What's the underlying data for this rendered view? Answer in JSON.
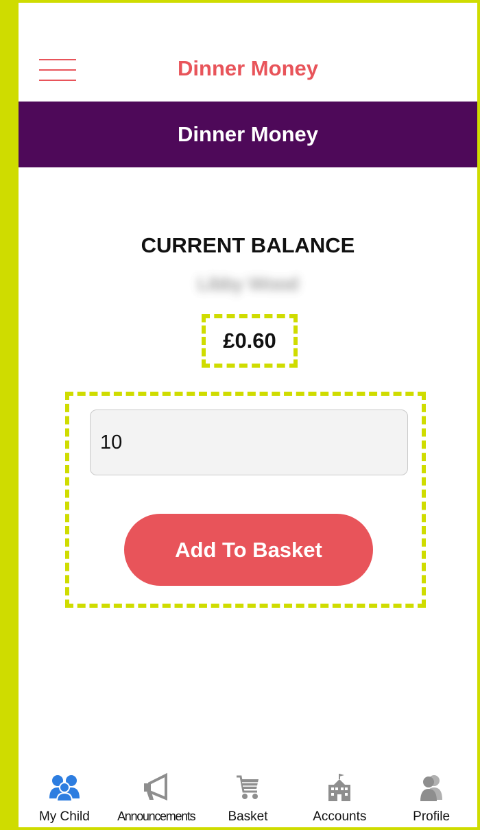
{
  "header": {
    "title": "Dinner Money",
    "menu_icon": "hamburger-menu-icon",
    "accent_color": "#e8545a"
  },
  "banner": {
    "title": "Dinner Money",
    "background": "#4e0959"
  },
  "balance": {
    "heading": "CURRENT BALANCE",
    "child_name": "Libby Wood",
    "amount": "£0.60"
  },
  "topup": {
    "amount_value": "10",
    "add_button_label": "Add To Basket"
  },
  "tabbar": {
    "active_color": "#2d7de0",
    "inactive_color": "#8e8e8e",
    "tabs": [
      {
        "label": "My Child",
        "icon": "people-icon",
        "active": true
      },
      {
        "label": "Announcements",
        "icon": "megaphone-icon",
        "active": false
      },
      {
        "label": "Basket",
        "icon": "shopping-cart-icon",
        "active": false
      },
      {
        "label": "Accounts",
        "icon": "school-building-icon",
        "active": false
      },
      {
        "label": "Profile",
        "icon": "profile-icon",
        "active": false
      }
    ]
  },
  "annotation_color": "#cfdc00"
}
